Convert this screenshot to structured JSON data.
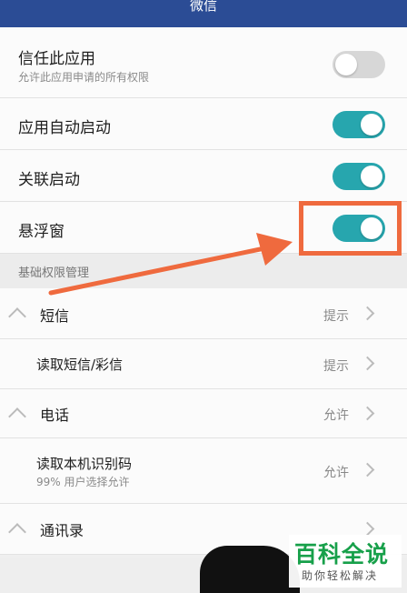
{
  "app_title": "微信",
  "colors": {
    "toggle_on": "#27a6ae",
    "toggle_off": "#d7d7d7",
    "titlebar": "#2b4c95",
    "annotation": "#ef6a3e",
    "watermark_green": "#17a04a"
  },
  "settings": [
    {
      "title": "信任此应用",
      "subtitle": "允许此应用申请的所有权限",
      "enabled": false
    },
    {
      "title": "应用自动启动",
      "enabled": true
    },
    {
      "title": "关联启动",
      "enabled": true
    },
    {
      "title": "悬浮窗",
      "enabled": true
    }
  ],
  "section_header": "基础权限管理",
  "permissions": [
    {
      "label": "短信",
      "status": "提示",
      "group": true
    },
    {
      "label": "读取短信/彩信",
      "status": "提示",
      "group": false
    },
    {
      "label": "电话",
      "status": "允许",
      "group": true
    },
    {
      "label": "读取本机识别码",
      "subtitle": "99% 用户选择允许",
      "status": "允许",
      "group": false
    },
    {
      "label": "通讯录",
      "status": "",
      "group": true
    }
  ],
  "watermark": {
    "title": "百科全说",
    "subtitle": "助你轻松解决"
  }
}
